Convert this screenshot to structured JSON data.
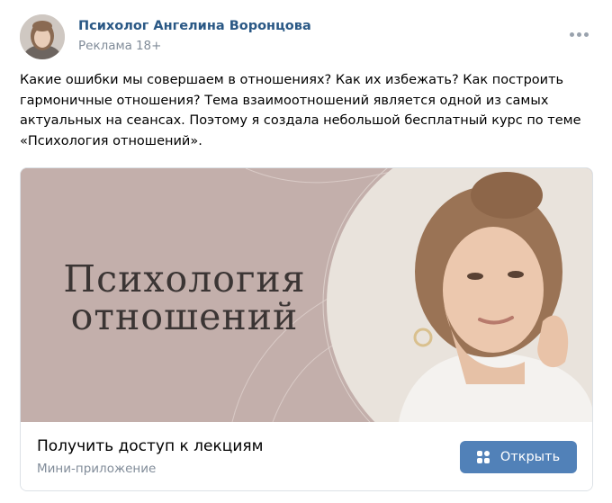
{
  "post": {
    "author": "Психолог Ангелина Воронцова",
    "ad_label": "Реклама",
    "age_rating": "18+",
    "more_icon": "more-horizontal-icon",
    "text_lines": [
      "Какие ошибки мы совершаем в отношениях? Как их избежать? Как построить",
      "гармоничные отношения? Тема взаимоотношений является одной из самых",
      "актуальных на сеансах. Поэтому я создала небольшой бесплатный курс по теме",
      "«Психология отношений»."
    ]
  },
  "banner": {
    "title_line1": "Психология",
    "title_line2": "отношений"
  },
  "cta": {
    "title": "Получить доступ к лекциям",
    "subtitle": "Мини-приложение",
    "button_label": "Открыть",
    "button_icon": "apps-icon"
  },
  "colors": {
    "author_link": "#2a5885",
    "secondary_text": "#818c99",
    "button": "#5181b8",
    "banner_bg": "#c3afab"
  }
}
